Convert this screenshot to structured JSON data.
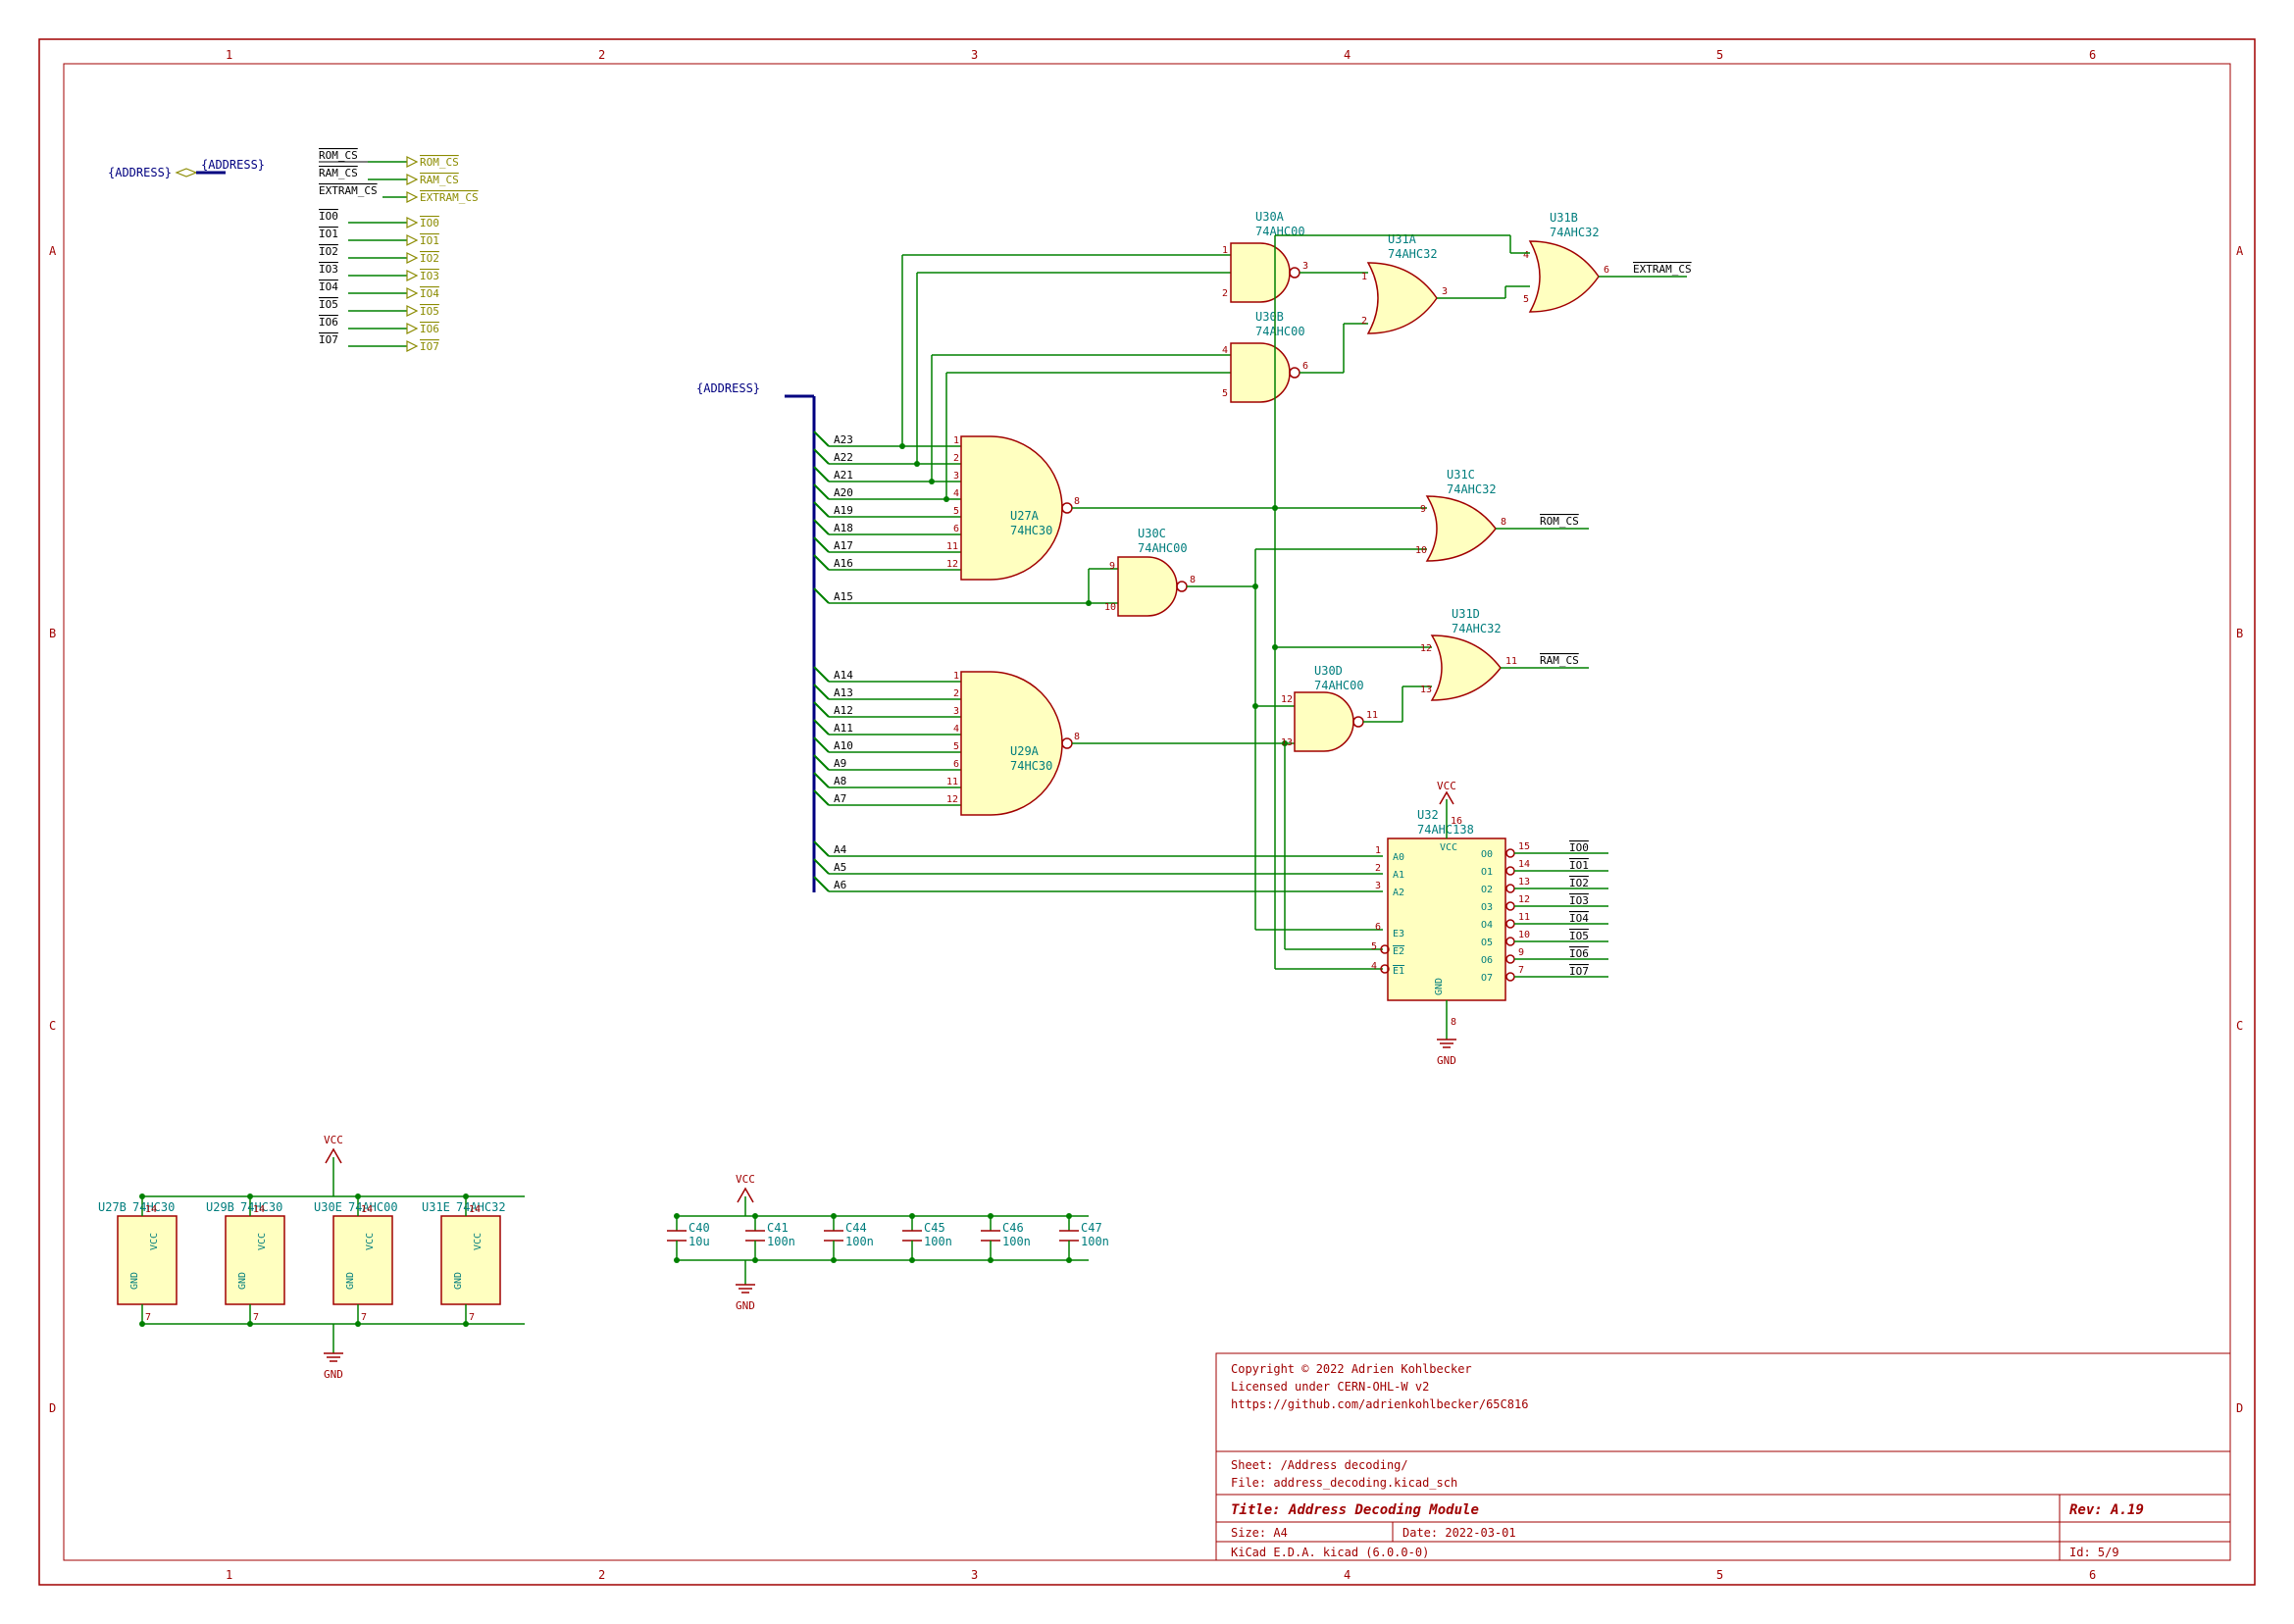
{
  "frame": {
    "cols": [
      "1",
      "2",
      "3",
      "4",
      "5",
      "6"
    ],
    "rows": [
      "A",
      "B",
      "C",
      "D"
    ]
  },
  "title_block": {
    "copyright": "Copyright © 2022 Adrien Kohlbecker",
    "license": "Licensed under CERN-OHL-W v2",
    "url": "https://github.com/adrienkohlbecker/65C816",
    "sheet": "Sheet: /Address decoding/",
    "file": "File: address_decoding.kicad_sch",
    "title_prefix": "Title: ",
    "title": "Address Decoding Module",
    "size_label": "Size:",
    "size": "A4",
    "date_label": "Date:",
    "date": "2022-03-01",
    "rev_label": "Rev:",
    "rev": "A.19",
    "tool": "KiCad E.D.A.  kicad (6.0.0-0)",
    "id_label": "Id:",
    "id": "5/9"
  },
  "hier_labels": {
    "address_sheet": "{ADDRESS}",
    "address_bus": "{ADDRESS}",
    "rom_cs": "ROM_CS",
    "rom_cs2": "ROM_CS",
    "ram_cs": "RAM_CS",
    "ram_cs2": "RAM_CS",
    "extram_cs": "EXTRAM_CS",
    "extram_cs2": "EXTRAM_CS",
    "io0": "IO0",
    "io0b": "IO0",
    "io1": "IO1",
    "io1b": "IO1",
    "io2": "IO2",
    "io2b": "IO2",
    "io3": "IO3",
    "io3b": "IO3",
    "io4": "IO4",
    "io4b": "IO4",
    "io5": "IO5",
    "io5b": "IO5",
    "io6": "IO6",
    "io6b": "IO6",
    "io7": "IO7",
    "io7b": "IO7"
  },
  "addr_lines_upper": [
    "A23",
    "A22",
    "A21",
    "A20",
    "A19",
    "A18",
    "A17",
    "A16"
  ],
  "addr_lines_mid": "A15",
  "addr_lines_lower": [
    "A14",
    "A13",
    "A12",
    "A11",
    "A10",
    "A9",
    "A8",
    "A7"
  ],
  "addr_lines_dec": [
    "A4",
    "A5",
    "A6"
  ],
  "components": {
    "U27A": {
      "ref": "U27A",
      "val": "74HC30"
    },
    "U29A": {
      "ref": "U29A",
      "val": "74HC30"
    },
    "U30A": {
      "ref": "U30A",
      "val": "74AHC00"
    },
    "U30B": {
      "ref": "U30B",
      "val": "74AHC00"
    },
    "U30C": {
      "ref": "U30C",
      "val": "74AHC00"
    },
    "U30D": {
      "ref": "U30D",
      "val": "74AHC00"
    },
    "U31A": {
      "ref": "U31A",
      "val": "74AHC32"
    },
    "U31B": {
      "ref": "U31B",
      "val": "74AHC32"
    },
    "U31C": {
      "ref": "U31C",
      "val": "74AHC32"
    },
    "U31D": {
      "ref": "U31D",
      "val": "74AHC32"
    },
    "U32": {
      "ref": "U32",
      "val": "74AHC138",
      "pins_left": [
        {
          "n": "1",
          "nm": "A0"
        },
        {
          "n": "2",
          "nm": "A1"
        },
        {
          "n": "3",
          "nm": "A2"
        },
        {
          "n": "6",
          "nm": "E3"
        },
        {
          "n": "5",
          "nm": "E2"
        },
        {
          "n": "4",
          "nm": "E1"
        }
      ],
      "pins_right": [
        {
          "n": "15",
          "nm": "O0"
        },
        {
          "n": "14",
          "nm": "O1"
        },
        {
          "n": "13",
          "nm": "O2"
        },
        {
          "n": "12",
          "nm": "O3"
        },
        {
          "n": "11",
          "nm": "O4"
        },
        {
          "n": "10",
          "nm": "O5"
        },
        {
          "n": "9",
          "nm": "O6"
        },
        {
          "n": "7",
          "nm": "O7"
        }
      ],
      "vcc": "VCC",
      "gnd": "GND",
      "vcc_pin": "16",
      "gnd_pin": "8"
    },
    "U27B": {
      "ref": "U27B",
      "val": "74HC30",
      "vcc": "VCC",
      "gnd": "GND",
      "p_hi": "14",
      "p_lo": "7"
    },
    "U29B": {
      "ref": "U29B",
      "val": "74HC30",
      "vcc": "VCC",
      "gnd": "GND",
      "p_hi": "14",
      "p_lo": "7"
    },
    "U30E": {
      "ref": "U30E",
      "val": "74AHC00",
      "vcc": "VCC",
      "gnd": "GND",
      "p_hi": "14",
      "p_lo": "7"
    },
    "U31E": {
      "ref": "U31E",
      "val": "74AHC32",
      "vcc": "VCC",
      "gnd": "GND",
      "p_hi": "14",
      "p_lo": "7"
    }
  },
  "caps": [
    {
      "ref": "C40",
      "val": "10u"
    },
    {
      "ref": "C41",
      "val": "100n"
    },
    {
      "ref": "C44",
      "val": "100n"
    },
    {
      "ref": "C45",
      "val": "100n"
    },
    {
      "ref": "C46",
      "val": "100n"
    },
    {
      "ref": "C47",
      "val": "100n"
    }
  ],
  "pwr": {
    "vcc": "VCC",
    "gnd": "GND"
  },
  "gate_pins": {
    "U30A": {
      "a": "1",
      "b": "2",
      "y": "3"
    },
    "U30B": {
      "a": "4",
      "b": "5",
      "y": "6"
    },
    "U30C": {
      "a": "9",
      "b": "10",
      "y": "8"
    },
    "U30D": {
      "a": "12",
      "b": "13",
      "y": "11"
    },
    "U31A": {
      "a": "1",
      "b": "2",
      "y": "3"
    },
    "U31B": {
      "a": "4",
      "b": "5",
      "y": "6"
    },
    "U31C": {
      "a": "9",
      "b": "10",
      "y": "8"
    },
    "U31D": {
      "a": "12",
      "b": "13",
      "y": "11"
    },
    "U27A": {
      "p": [
        "1",
        "2",
        "3",
        "4",
        "5",
        "6",
        "11",
        "12"
      ],
      "y": "8"
    },
    "U29A": {
      "p": [
        "1",
        "2",
        "3",
        "4",
        "5",
        "6",
        "11",
        "12"
      ],
      "y": "8"
    }
  },
  "outputs": {
    "extram": "EXTRAM_CS",
    "rom": "ROM_CS",
    "ram": "RAM_CS",
    "io": [
      "IO0",
      "IO1",
      "IO2",
      "IO3",
      "IO4",
      "IO5",
      "IO6",
      "IO7"
    ]
  }
}
